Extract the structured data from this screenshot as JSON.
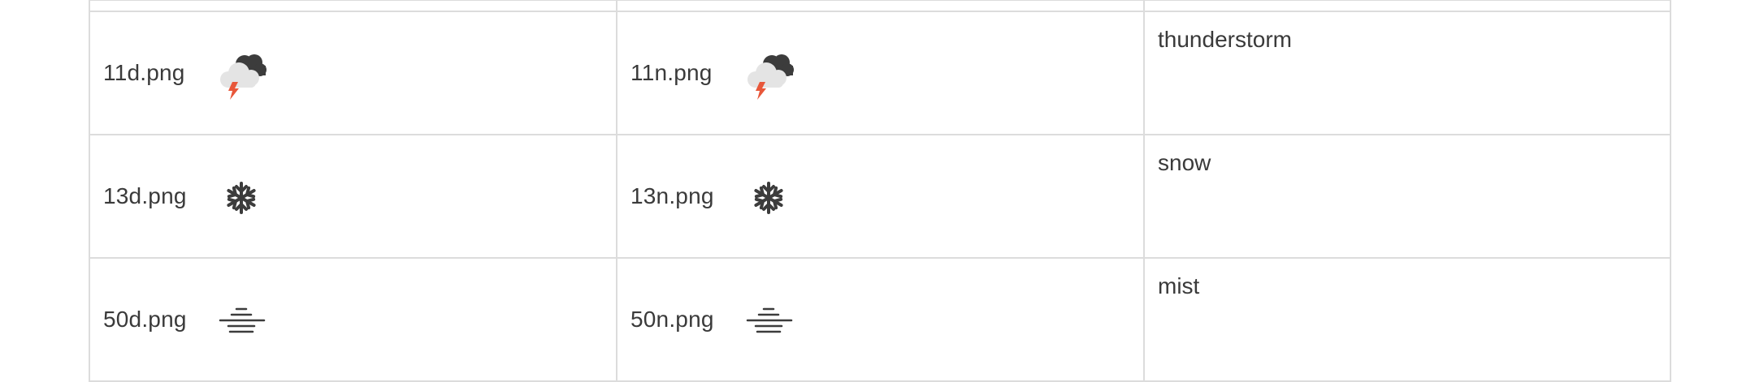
{
  "rows": [
    {
      "day_file": "11d.png",
      "day_icon": "thunderstorm-icon",
      "night_file": "11n.png",
      "night_icon": "thunderstorm-icon",
      "description": "thunderstorm"
    },
    {
      "day_file": "13d.png",
      "day_icon": "snowflake-icon",
      "night_file": "13n.png",
      "night_icon": "snowflake-icon",
      "description": "snow"
    },
    {
      "day_file": "50d.png",
      "day_icon": "mist-icon",
      "night_file": "50n.png",
      "night_icon": "mist-icon",
      "description": "mist"
    }
  ],
  "colors": {
    "border": "#dcdcdc",
    "text": "#3a3a3a",
    "icon_dark": "#3c3c3c",
    "cloud_light": "#e4e4e4",
    "lightning": "#e8573a"
  }
}
